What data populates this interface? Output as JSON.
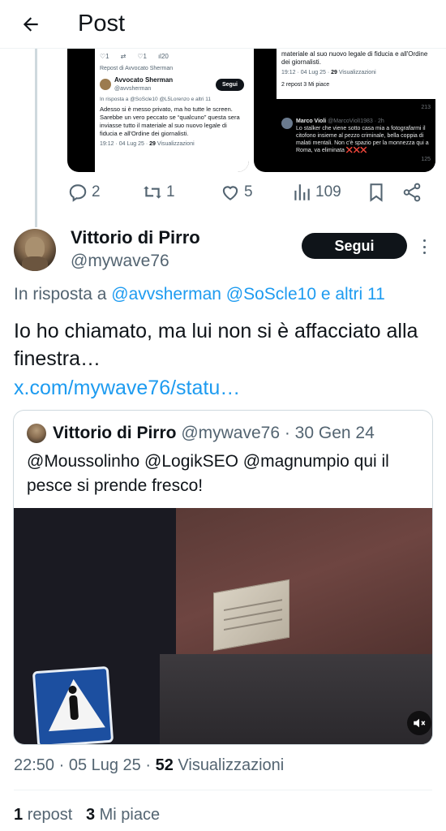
{
  "header": {
    "title": "Post",
    "back_icon": "arrow-left-icon"
  },
  "embedded_left": {
    "top_counts": [
      "1",
      "1",
      "20"
    ],
    "repost_note": "Repost di Avvocato Sherman",
    "author": "Avvocato Sherman",
    "handle": "@avvsherman",
    "follow": "Segui",
    "reply_line": "In risposta a @SoScle10 @L5Lorenzo e altri 11",
    "text": "Adesso si è messo privato, ma ho tutte le screen. Sarebbe un vero peccato se “qualcuno” questa sera inviasse tutto il materiale al suo nuovo legale di fiducia e all'Ordine dei giornalisti.",
    "meta_time": "19:12 · 04 Lug 25 ·",
    "meta_views_num": "29",
    "meta_views_label": "Visualizzazioni"
  },
  "embedded_right": {
    "text_top": "materiale al suo nuovo legale di fiducia e all'Ordine dei giornalisti.",
    "meta_time": "19:12 · 04 Lug 25 ·",
    "meta_views_num": "29",
    "meta_views_label": "Visualizzazioni",
    "stats": "2 repost  3 Mi piace",
    "count_views": "213",
    "reply_author": "Marco Violi",
    "reply_handle": "@MarcoViolI1983 · 2h",
    "reply_text": "Lo stalker che viene sotto casa mia a fotografarmi il citofono insieme al pezzo criminale, bella coppia di malati mentali. Non c'è spazio per la monnezza qui a Roma, va eliminata ❌❌❌",
    "reply_views": "125"
  },
  "actions": {
    "replies": "2",
    "reposts": "1",
    "likes": "5",
    "views": "109"
  },
  "post": {
    "author_name": "Vittorio di Pirro",
    "author_handle": "@mywave76",
    "follow_label": "Segui",
    "reply_prefix": "In risposta a",
    "reply_mentions": "@avvsherman @SoScle10 e altri 11",
    "text": "Io ho chiamato, ma lui non si è affacciato alla finestra…",
    "link": "x.com/mywave76/statu…",
    "time": "22:50 · 05 Lug 25 ·",
    "views_num": "52",
    "views_label": "Visualizzazioni",
    "reposts_num": "1",
    "reposts_label": "repost",
    "likes_num": "3",
    "likes_label": "Mi piace"
  },
  "quote": {
    "author_name": "Vittorio di Pirro",
    "author_handle": "@mywave76 · 30 Gen 24",
    "text": "@Moussolinho @LogikSEO @magnumpio qui il pesce si prende fresco!"
  },
  "colors": {
    "accent": "#1d9bf0",
    "text": "#0f1419",
    "muted": "#536471"
  }
}
